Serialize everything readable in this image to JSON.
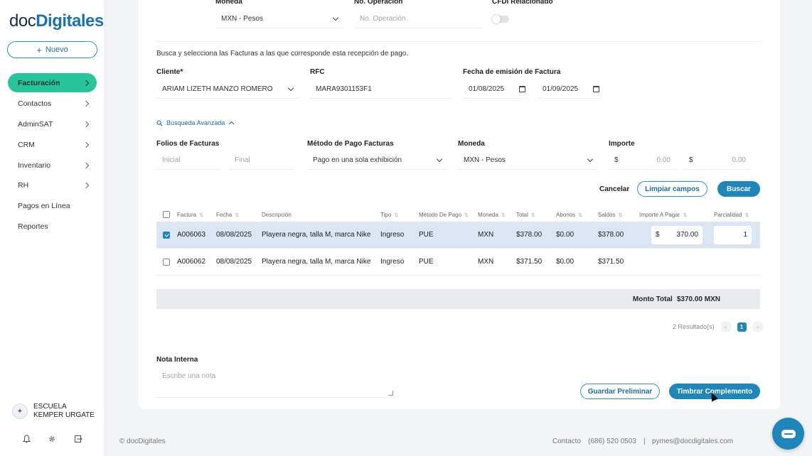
{
  "app": {
    "logo_prefix": "doc",
    "logo_suffix": "Digitales",
    "new_button": "Nuevo"
  },
  "sidebar": {
    "items": [
      {
        "label": "Facturación",
        "active": true,
        "has_chevron": true
      },
      {
        "label": "Contactos",
        "has_chevron": true
      },
      {
        "label": "AdminSAT",
        "has_chevron": true
      },
      {
        "label": "CRM",
        "has_chevron": true
      },
      {
        "label": "Inventario",
        "has_chevron": true
      },
      {
        "label": "RH",
        "has_chevron": true
      },
      {
        "label": "Pagos en Línea",
        "has_chevron": false
      },
      {
        "label": "Reportes",
        "has_chevron": false
      }
    ],
    "org_name": "ESCUELA KEMPER URGATE",
    "footer_icons": [
      "bell-icon",
      "gear-icon",
      "logout-icon"
    ]
  },
  "top_row": {
    "moneda_label": "Moneda",
    "moneda_value": "MXN - Pesos",
    "operacion_label": "No. Operación",
    "operacion_placeholder": "No. Operación",
    "cfdi_label": "CFDI Relacionado",
    "cfdi_toggle_on": false
  },
  "search": {
    "instructions": "Busca y selecciona las Facturas a las que corresponde esta recepción de pago.",
    "cliente_label": "Cliente*",
    "cliente_value": "ARIAM LIZETH MANZO ROMERO",
    "rfc_label": "RFC",
    "rfc_value": "MARA9301153F1",
    "fecha_label": "Fecha de emisión de Factura",
    "fecha_desde": "01/08/2025",
    "fecha_hasta": "01/09/2025",
    "advanced_label": "Búsqueda Avanzada",
    "folios_label": "Folios de Facturas",
    "folio_inicial_placeholder": "Inicial",
    "folio_final_placeholder": "Final",
    "metodo_label": "Método de Pago Facturas",
    "metodo_value": "Pago en una sola exhibición",
    "moneda_label": "Moneda",
    "moneda_value": "MXN - Pesos",
    "importe_label": "Importe",
    "importe_symbol": "$",
    "importe_min": "0.00",
    "importe_max": "0.00",
    "cancel_label": "Cancelar",
    "clear_label": "Limpiar campos",
    "search_label": "Buscar"
  },
  "table": {
    "columns": [
      "Factura",
      "Fecha",
      "Descripción",
      "Tipo",
      "Método De Pago",
      "Moneda",
      "Total",
      "Abonos",
      "Saldos",
      "Importe A Pagar",
      "Parcialidad"
    ],
    "rows": [
      {
        "selected": true,
        "factura": "A006063",
        "fecha": "08/08/2025",
        "descripcion": "Playera negra, talla M, marca Nike",
        "tipo": "Ingreso",
        "metodo": "PUE",
        "moneda": "MXN",
        "total": "$378.00",
        "abonos": "$0.00",
        "saldos": "$378.00",
        "importe_symbol": "$",
        "importe": "370.00",
        "parcialidad": "1"
      },
      {
        "selected": false,
        "factura": "A006062",
        "fecha": "08/08/2025",
        "descripcion": "Playera negra, talla M, marca Nike",
        "tipo": "Ingreso",
        "metodo": "PUE",
        "moneda": "MXN",
        "total": "$371.50",
        "abonos": "$0.00",
        "saldos": "$371.50"
      }
    ],
    "total_label": "Monto Total",
    "total_value": "$370.00 MXN",
    "results_label": "2 Resultado(s)",
    "current_page": "1"
  },
  "notes": {
    "label": "Nota Interna",
    "placeholder": "Escribe una nota"
  },
  "actions": {
    "preliminar_label": "Guardar Preliminar",
    "timbrar_label": "Timbrar Complemento"
  },
  "footer": {
    "copyright": "© docDigitales",
    "contact_label": "Contacto",
    "phone": "(686) 520 0503",
    "separator": "|",
    "email": "pymes@docdigitales.com"
  },
  "colors": {
    "accent": "#1e86b8",
    "active_nav": "#29c59a",
    "selected_row": "#dbe6f2"
  }
}
